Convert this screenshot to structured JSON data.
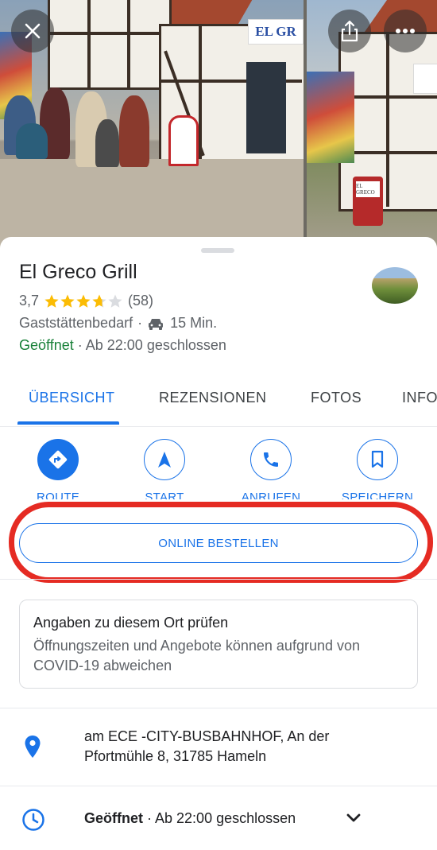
{
  "photo_header": {
    "sign_text_1": "EL GR",
    "sign_text_2": "EL GRECO"
  },
  "header_buttons": {
    "close": "close-icon",
    "share": "share-icon",
    "more": "more-icon"
  },
  "place": {
    "name": "El Greco Grill",
    "rating": "3,7",
    "rating_value": 3.7,
    "review_count": "(58)",
    "category": "Gaststättenbedarf",
    "separator": "·",
    "drive_time": "15 Min.",
    "open_status": "Geöffnet",
    "closing": "· Ab 22:00 geschlossen"
  },
  "tabs": [
    {
      "label": "ÜBERSICHT",
      "active": true
    },
    {
      "label": "REZENSIONEN",
      "active": false
    },
    {
      "label": "FOTOS",
      "active": false
    },
    {
      "label": "INFO",
      "active": false
    }
  ],
  "actions": [
    {
      "label": "ROUTE",
      "icon": "directions-icon"
    },
    {
      "label": "START",
      "icon": "navigation-icon"
    },
    {
      "label": "ANRUFEN",
      "icon": "phone-icon"
    },
    {
      "label": "SPEICHERN",
      "icon": "bookmark-icon"
    }
  ],
  "order_button": "ONLINE BESTELLEN",
  "notice": {
    "title": "Angaben zu diesem Ort prüfen",
    "text": "Öffnungszeiten und Angebote können aufgrund von COVID-19 abweichen"
  },
  "address": {
    "line1": "am ECE -CITY-BUSBAHNHOF, An der",
    "line2": "Pfortmühle 8, 31785 Hameln"
  },
  "hours": {
    "status": "Geöffnet",
    "text": "· Ab 22:00 geschlossen"
  },
  "colors": {
    "accent": "#1a73e8",
    "open_green": "#188038",
    "star": "#fbbc04",
    "highlight_red": "#e52b23"
  }
}
